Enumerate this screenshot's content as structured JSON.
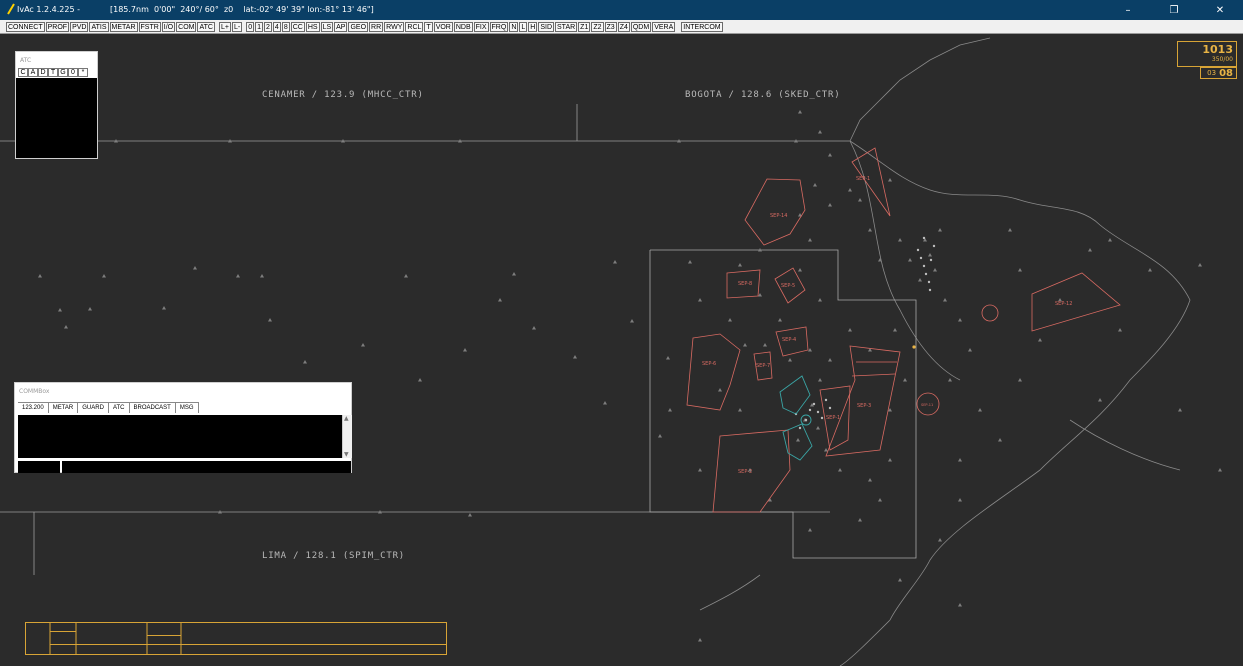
{
  "titlebar": {
    "app_title": "IvAc 1.2.4.225 -",
    "info": "[185.7nm  0'00\"  240°/ 60°  z0    lat:-02° 49' 39\" lon:-81° 13' 46\"]",
    "minimize": "–",
    "restore": "❐",
    "close": "✕"
  },
  "toolbar": {
    "buttons": [
      "CONNECT",
      "PROF",
      "PVD",
      "ATIS",
      "METAR",
      "FSTR",
      "I/O",
      "COM",
      "ATC",
      "L+",
      "L-",
      "0",
      "1",
      "2",
      "4",
      "8",
      "CC",
      "HS",
      "LS",
      "AP",
      "GEO",
      "RR",
      "RWY",
      "RCL",
      "T",
      "VOR",
      "NDB",
      "FIX",
      "FRQ",
      "N",
      "L",
      "H",
      "SID",
      "STAR",
      "Z1",
      "Z2",
      "Z3",
      "Z4",
      "QDM",
      "VERA",
      "INTERCOM"
    ]
  },
  "qnh": {
    "value": "1013",
    "sub": "350/00"
  },
  "clock": {
    "hour": "03",
    "minute": "08"
  },
  "atc_panel": {
    "title": "ATC",
    "tabs": [
      "C",
      "A",
      "D",
      "T",
      "G",
      "0",
      "*"
    ]
  },
  "commbox": {
    "title": "COMMBox",
    "tabs": [
      "123.200",
      "METAR",
      "GUARD",
      "ATC",
      "BROADCAST",
      "MSG"
    ]
  },
  "sectors": {
    "cenamer": "CENAMER / 123.9 (MHCC_CTR)",
    "bogota": "BOGOTA / 128.6 (SKED_CTR)",
    "lima": "LIMA / 128.1 (SPIM_CTR)"
  },
  "airspaces": {
    "sep1": "SEP-1",
    "sep14": "SEP-14",
    "sep8": "SEP-8",
    "sep5": "SEP-5",
    "sep4": "SEP-4",
    "sep6": "SEP-6",
    "sep7": "SEP-7",
    "sep3": "SEP-3",
    "sepx": "SEP-1",
    "sep2": "SEP-2",
    "sep12": "SEP-12",
    "sep11": "SEP-11"
  },
  "colors": {
    "background": "#2b2b2b",
    "titlebar": "#0a3f66",
    "restricted": "#d86a62",
    "tma": "#3aa6a6",
    "accent": "#e9b445"
  }
}
